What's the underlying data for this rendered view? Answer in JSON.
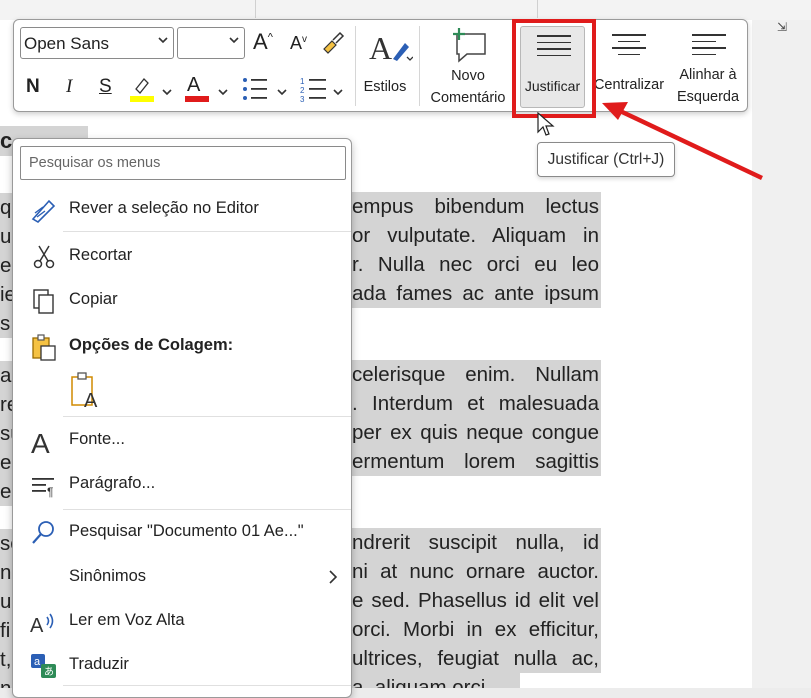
{
  "document": {
    "title_fragment": "c",
    "right_lines": [
      "empus bibendum lectus",
      "or vulputate. Aliquam in",
      "r. Nulla nec orci eu leo",
      "ada fames ac ante ipsum",
      "celerisque enim. Nullam",
      ". Interdum et malesuada",
      "per ex quis neque congue",
      "ermentum lorem sagittis",
      "ndrerit suscipit nulla, id",
      "ni at nunc ornare auctor.",
      "e sed. Phasellus id elit vel",
      "orci. Morbi in ex efficitur,",
      "ultrices, feugiat nulla ac,",
      "a, aliquam orci."
    ],
    "left_chars": [
      "q",
      "u",
      "e.",
      "ie",
      "s",
      "al",
      "re",
      "su",
      "e.",
      "e",
      "so",
      "n",
      "ue",
      "fi",
      "t,",
      "n"
    ]
  },
  "toolbar": {
    "font_name": "Open Sans",
    "font_size": "",
    "grow_font": "A",
    "shrink_font": "A",
    "bold": "N",
    "italic": "I",
    "underline": "S",
    "font_color_letter": "A",
    "styles_label": "Estilos",
    "new_comment_label_1": "Novo",
    "new_comment_label_2": "Comentário",
    "justify_label": "Justificar",
    "center_label": "Centralizar",
    "align_left_label_1": "Alinhar à",
    "align_left_label_2": "Esquerda",
    "highlight_color": "#ffff00",
    "font_color": "#e01b1b"
  },
  "tooltip": {
    "text": "Justificar (Ctrl+J)"
  },
  "context_menu": {
    "search_placeholder": "Pesquisar os menus",
    "items": [
      {
        "label": "Rever a seleção no Editor"
      },
      {
        "label": "Recortar"
      },
      {
        "label": "Copiar"
      },
      {
        "label": "Opções de Colagem:"
      },
      {
        "label": "Fonte..."
      },
      {
        "label": "Parágrafo..."
      },
      {
        "label": "Pesquisar \"Documento 01 Ae...\""
      },
      {
        "label": "Sinônimos"
      },
      {
        "label": "Ler em Voz Alta"
      },
      {
        "label": "Traduzir"
      }
    ]
  },
  "colors": {
    "annotation_red": "#e01b1b",
    "selection_gray": "#d4d4d4"
  }
}
